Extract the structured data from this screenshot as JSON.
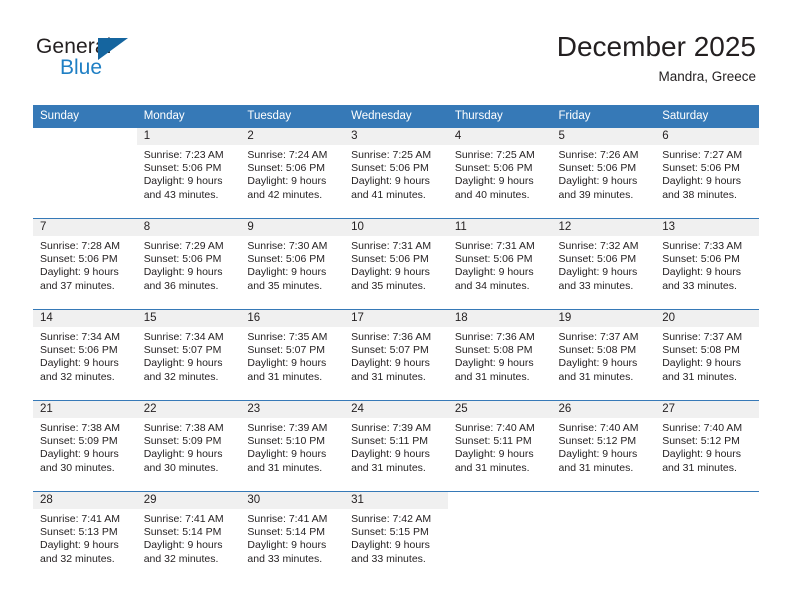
{
  "brand": {
    "name_part1": "General",
    "name_part2": "Blue",
    "accent_color": "#1f7fc4",
    "triangle_color": "#15659f"
  },
  "header": {
    "title": "December 2025",
    "location": "Mandra, Greece",
    "header_bg": "#3679b7",
    "cell_head_bg": "#f0f0f0"
  },
  "weekdays": [
    "Sunday",
    "Monday",
    "Tuesday",
    "Wednesday",
    "Thursday",
    "Friday",
    "Saturday"
  ],
  "weeks": [
    [
      {
        "day": "",
        "blank": true,
        "sunrise": "",
        "sunset": "",
        "daylight1": "",
        "daylight2": ""
      },
      {
        "day": "1",
        "sunrise": "Sunrise: 7:23 AM",
        "sunset": "Sunset: 5:06 PM",
        "daylight1": "Daylight: 9 hours",
        "daylight2": "and 43 minutes."
      },
      {
        "day": "2",
        "sunrise": "Sunrise: 7:24 AM",
        "sunset": "Sunset: 5:06 PM",
        "daylight1": "Daylight: 9 hours",
        "daylight2": "and 42 minutes."
      },
      {
        "day": "3",
        "sunrise": "Sunrise: 7:25 AM",
        "sunset": "Sunset: 5:06 PM",
        "daylight1": "Daylight: 9 hours",
        "daylight2": "and 41 minutes."
      },
      {
        "day": "4",
        "sunrise": "Sunrise: 7:25 AM",
        "sunset": "Sunset: 5:06 PM",
        "daylight1": "Daylight: 9 hours",
        "daylight2": "and 40 minutes."
      },
      {
        "day": "5",
        "sunrise": "Sunrise: 7:26 AM",
        "sunset": "Sunset: 5:06 PM",
        "daylight1": "Daylight: 9 hours",
        "daylight2": "and 39 minutes."
      },
      {
        "day": "6",
        "sunrise": "Sunrise: 7:27 AM",
        "sunset": "Sunset: 5:06 PM",
        "daylight1": "Daylight: 9 hours",
        "daylight2": "and 38 minutes."
      }
    ],
    [
      {
        "day": "7",
        "sunrise": "Sunrise: 7:28 AM",
        "sunset": "Sunset: 5:06 PM",
        "daylight1": "Daylight: 9 hours",
        "daylight2": "and 37 minutes."
      },
      {
        "day": "8",
        "sunrise": "Sunrise: 7:29 AM",
        "sunset": "Sunset: 5:06 PM",
        "daylight1": "Daylight: 9 hours",
        "daylight2": "and 36 minutes."
      },
      {
        "day": "9",
        "sunrise": "Sunrise: 7:30 AM",
        "sunset": "Sunset: 5:06 PM",
        "daylight1": "Daylight: 9 hours",
        "daylight2": "and 35 minutes."
      },
      {
        "day": "10",
        "sunrise": "Sunrise: 7:31 AM",
        "sunset": "Sunset: 5:06 PM",
        "daylight1": "Daylight: 9 hours",
        "daylight2": "and 35 minutes."
      },
      {
        "day": "11",
        "sunrise": "Sunrise: 7:31 AM",
        "sunset": "Sunset: 5:06 PM",
        "daylight1": "Daylight: 9 hours",
        "daylight2": "and 34 minutes."
      },
      {
        "day": "12",
        "sunrise": "Sunrise: 7:32 AM",
        "sunset": "Sunset: 5:06 PM",
        "daylight1": "Daylight: 9 hours",
        "daylight2": "and 33 minutes."
      },
      {
        "day": "13",
        "sunrise": "Sunrise: 7:33 AM",
        "sunset": "Sunset: 5:06 PM",
        "daylight1": "Daylight: 9 hours",
        "daylight2": "and 33 minutes."
      }
    ],
    [
      {
        "day": "14",
        "sunrise": "Sunrise: 7:34 AM",
        "sunset": "Sunset: 5:06 PM",
        "daylight1": "Daylight: 9 hours",
        "daylight2": "and 32 minutes."
      },
      {
        "day": "15",
        "sunrise": "Sunrise: 7:34 AM",
        "sunset": "Sunset: 5:07 PM",
        "daylight1": "Daylight: 9 hours",
        "daylight2": "and 32 minutes."
      },
      {
        "day": "16",
        "sunrise": "Sunrise: 7:35 AM",
        "sunset": "Sunset: 5:07 PM",
        "daylight1": "Daylight: 9 hours",
        "daylight2": "and 31 minutes."
      },
      {
        "day": "17",
        "sunrise": "Sunrise: 7:36 AM",
        "sunset": "Sunset: 5:07 PM",
        "daylight1": "Daylight: 9 hours",
        "daylight2": "and 31 minutes."
      },
      {
        "day": "18",
        "sunrise": "Sunrise: 7:36 AM",
        "sunset": "Sunset: 5:08 PM",
        "daylight1": "Daylight: 9 hours",
        "daylight2": "and 31 minutes."
      },
      {
        "day": "19",
        "sunrise": "Sunrise: 7:37 AM",
        "sunset": "Sunset: 5:08 PM",
        "daylight1": "Daylight: 9 hours",
        "daylight2": "and 31 minutes."
      },
      {
        "day": "20",
        "sunrise": "Sunrise: 7:37 AM",
        "sunset": "Sunset: 5:08 PM",
        "daylight1": "Daylight: 9 hours",
        "daylight2": "and 31 minutes."
      }
    ],
    [
      {
        "day": "21",
        "sunrise": "Sunrise: 7:38 AM",
        "sunset": "Sunset: 5:09 PM",
        "daylight1": "Daylight: 9 hours",
        "daylight2": "and 30 minutes."
      },
      {
        "day": "22",
        "sunrise": "Sunrise: 7:38 AM",
        "sunset": "Sunset: 5:09 PM",
        "daylight1": "Daylight: 9 hours",
        "daylight2": "and 30 minutes."
      },
      {
        "day": "23",
        "sunrise": "Sunrise: 7:39 AM",
        "sunset": "Sunset: 5:10 PM",
        "daylight1": "Daylight: 9 hours",
        "daylight2": "and 31 minutes."
      },
      {
        "day": "24",
        "sunrise": "Sunrise: 7:39 AM",
        "sunset": "Sunset: 5:11 PM",
        "daylight1": "Daylight: 9 hours",
        "daylight2": "and 31 minutes."
      },
      {
        "day": "25",
        "sunrise": "Sunrise: 7:40 AM",
        "sunset": "Sunset: 5:11 PM",
        "daylight1": "Daylight: 9 hours",
        "daylight2": "and 31 minutes."
      },
      {
        "day": "26",
        "sunrise": "Sunrise: 7:40 AM",
        "sunset": "Sunset: 5:12 PM",
        "daylight1": "Daylight: 9 hours",
        "daylight2": "and 31 minutes."
      },
      {
        "day": "27",
        "sunrise": "Sunrise: 7:40 AM",
        "sunset": "Sunset: 5:12 PM",
        "daylight1": "Daylight: 9 hours",
        "daylight2": "and 31 minutes."
      }
    ],
    [
      {
        "day": "28",
        "sunrise": "Sunrise: 7:41 AM",
        "sunset": "Sunset: 5:13 PM",
        "daylight1": "Daylight: 9 hours",
        "daylight2": "and 32 minutes."
      },
      {
        "day": "29",
        "sunrise": "Sunrise: 7:41 AM",
        "sunset": "Sunset: 5:14 PM",
        "daylight1": "Daylight: 9 hours",
        "daylight2": "and 32 minutes."
      },
      {
        "day": "30",
        "sunrise": "Sunrise: 7:41 AM",
        "sunset": "Sunset: 5:14 PM",
        "daylight1": "Daylight: 9 hours",
        "daylight2": "and 33 minutes."
      },
      {
        "day": "31",
        "sunrise": "Sunrise: 7:42 AM",
        "sunset": "Sunset: 5:15 PM",
        "daylight1": "Daylight: 9 hours",
        "daylight2": "and 33 minutes."
      },
      {
        "day": "",
        "blank": true,
        "sunrise": "",
        "sunset": "",
        "daylight1": "",
        "daylight2": ""
      },
      {
        "day": "",
        "blank": true,
        "sunrise": "",
        "sunset": "",
        "daylight1": "",
        "daylight2": ""
      },
      {
        "day": "",
        "blank": true,
        "sunrise": "",
        "sunset": "",
        "daylight1": "",
        "daylight2": ""
      }
    ]
  ]
}
